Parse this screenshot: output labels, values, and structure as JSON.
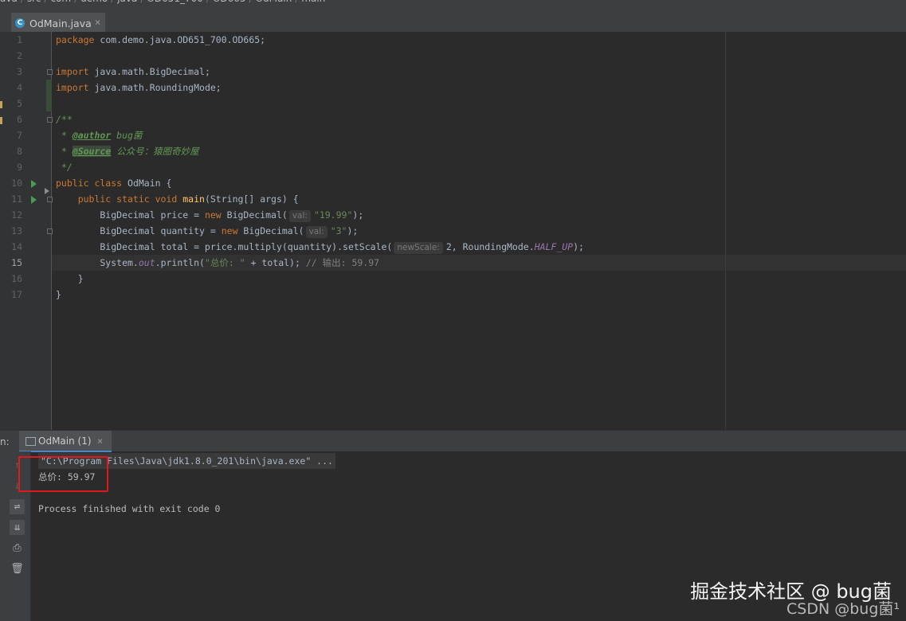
{
  "breadcrumb": [
    "ava",
    "src",
    "com",
    "demo",
    "java",
    "OD651_700",
    "OD665",
    "OdMain",
    "main"
  ],
  "editor_tab": {
    "label": "OdMain.java",
    "close": "×",
    "icon": "class-icon"
  },
  "line_numbers": [
    "1",
    "2",
    "3",
    "4",
    "5",
    "6",
    "7",
    "8",
    "9",
    "10",
    "11",
    "12",
    "13",
    "14",
    "15",
    "16",
    "17"
  ],
  "code": {
    "l1_kw": "package",
    "l1_rest": " com.demo.java.OD651_700.OD665;",
    "l3_kw": "import",
    "l3_rest": " java.math.BigDecimal;",
    "l4_kw": "import",
    "l4_rest": " java.math.RoundingMode;",
    "l6": "/**",
    "l7_star": " * ",
    "l7_tag": "@author",
    "l7_val": " bug菌",
    "l8_star": " * ",
    "l8_tag": "@Source",
    "l8_val": " 公众号：猿圈奇妙屋",
    "l9": " */",
    "l10_kw": "public class",
    "l10_rest": " OdMain {",
    "l11_kw": "    public static void",
    "l11_mth": " main",
    "l11_rest": "(String[] args) {",
    "l12_a": "        BigDecimal price = ",
    "l12_kw": "new",
    "l12_b": " BigDecimal(",
    "l12_hint": "val:",
    "l12_str": "\"19.99\"",
    "l12_c": ");",
    "l13_a": "        BigDecimal quantity = ",
    "l13_kw": "new",
    "l13_b": " BigDecimal(",
    "l13_hint": "val:",
    "l13_str": "\"3\"",
    "l13_c": ");",
    "l14_a": "        BigDecimal total = price.multiply(quantity).setScale(",
    "l14_hint": "newScale:",
    "l14_b": "2, RoundingMode.",
    "l14_fld": "HALF_UP",
    "l14_c": ");",
    "l15_a": "        System.",
    "l15_fld": "out",
    "l15_b": ".println(",
    "l15_str": "\"总价: \"",
    "l15_c": " + total); ",
    "l15_cmt": "// 输出: 59.97",
    "l16": "    }",
    "l17": "}"
  },
  "run_panel": {
    "label": "n:",
    "tab_label": "OdMain (1)",
    "tab_close": "×",
    "cmd_line": "\"C:\\Program Files\\Java\\jdk1.8.0_201\\bin\\java.exe\" ...",
    "stdout": "总价: 59.97",
    "exit_line": "Process finished with exit code 0"
  },
  "watermark": {
    "line1": "掘金技术社区 @ bug菌",
    "line2": "CSDN @bug菌¹"
  }
}
